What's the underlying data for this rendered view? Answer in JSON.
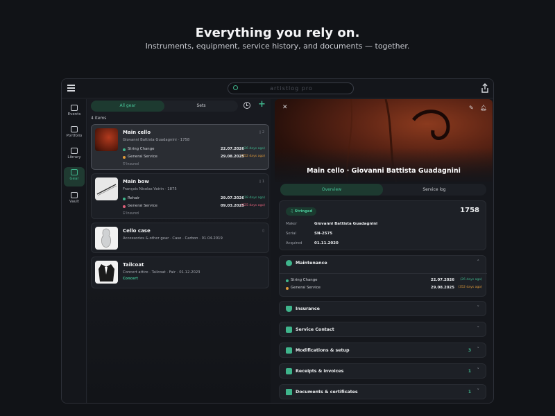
{
  "hero": {
    "title": "Everything you rely on.",
    "subtitle": "Instruments, equipment, service history, and documents — together."
  },
  "topbar": {
    "search_text": "artistlog pro"
  },
  "rail": [
    {
      "label": "Events",
      "icon": "calendar-icon",
      "active": false
    },
    {
      "label": "Portfolio",
      "icon": "portfolio-icon",
      "active": false
    },
    {
      "label": "Library",
      "icon": "library-icon",
      "active": false
    },
    {
      "label": "Gear",
      "icon": "gear-sliders-icon",
      "active": true
    },
    {
      "label": "Vault",
      "icon": "vault-icon",
      "active": false
    }
  ],
  "list": {
    "tabs": [
      "All gear",
      "Sets"
    ],
    "count": "4 items",
    "items": [
      {
        "title": "Main cello",
        "subtitle": "Giovanni Battista Guadagnini · 1758",
        "tag": "2",
        "services": [
          {
            "name": "String Change",
            "date": "22.07.2026",
            "rel": "(26 days ago)",
            "color": "#3fb58c"
          },
          {
            "name": "General Service",
            "date": "29.08.2025",
            "rel": "(352 days ago)",
            "color": "#e09a3a"
          }
        ],
        "status": "Insured"
      },
      {
        "title": "Main bow",
        "subtitle": "François Nicolas Voirin · 1875",
        "tag": "1",
        "services": [
          {
            "name": "Rehair",
            "date": "29.07.2026",
            "rel": "(18 days ago)",
            "color": "#3fb58c"
          },
          {
            "name": "General Service",
            "date": "09.03.2025",
            "rel": "(525 days ago)",
            "color": "#e0607a"
          }
        ],
        "status": "Insured"
      },
      {
        "title": "Cello case",
        "subtitle": "Accessories & other gear · Case · Carbon · 01.04.2019"
      },
      {
        "title": "Tailcoat",
        "subtitle": "Concert attire · Tailcoat · Fair · 01.12.2023",
        "note": "Concert"
      }
    ]
  },
  "detail": {
    "title": "Main cello · Giovanni Battista Guadagnini",
    "tabs": [
      "Overview",
      "Service log"
    ],
    "info": {
      "pill": "Stringed",
      "year": "1758",
      "rows": [
        {
          "k": "Maker",
          "v": "Giovanni Battista Guadagnini"
        },
        {
          "k": "Serial",
          "v": "SN-2575"
        },
        {
          "k": "Acquired",
          "v": "01.11.2020"
        }
      ]
    },
    "maintenance": {
      "title": "Maintenance",
      "services": [
        {
          "name": "String Change",
          "date": "22.07.2026",
          "rel": "(26 days ago)",
          "color": "#3fb58c"
        },
        {
          "name": "General Service",
          "date": "29.08.2025",
          "rel": "(352 days ago)",
          "color": "#e09a3a"
        }
      ]
    },
    "sections": [
      {
        "title": "Insurance",
        "count": ""
      },
      {
        "title": "Service Contact",
        "count": ""
      },
      {
        "title": "Modifications & setup",
        "count": "3"
      },
      {
        "title": "Receipts & invoices",
        "count": "1"
      },
      {
        "title": "Documents & certificates",
        "count": "1"
      }
    ]
  },
  "colors": {
    "accent": "#3fb58c",
    "warn": "#e09a3a",
    "bg": "#111317"
  }
}
